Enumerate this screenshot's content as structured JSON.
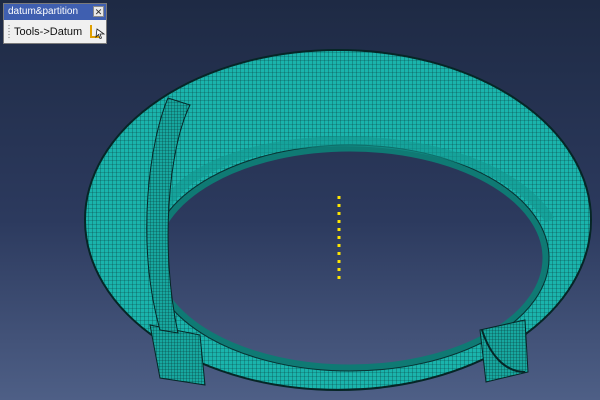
{
  "toolbar": {
    "title": "datum&partition",
    "tool_label": "Tools->Datum",
    "close_icon": "close-icon",
    "tool_icon": "datum-tool-icon"
  },
  "viewport": {
    "background_top": "#1e2a44",
    "background_bottom": "#4e5f86",
    "model_color": "#1ab4ac",
    "mesh_color": "#0a3a3a",
    "axis_color": "#ffe600"
  }
}
